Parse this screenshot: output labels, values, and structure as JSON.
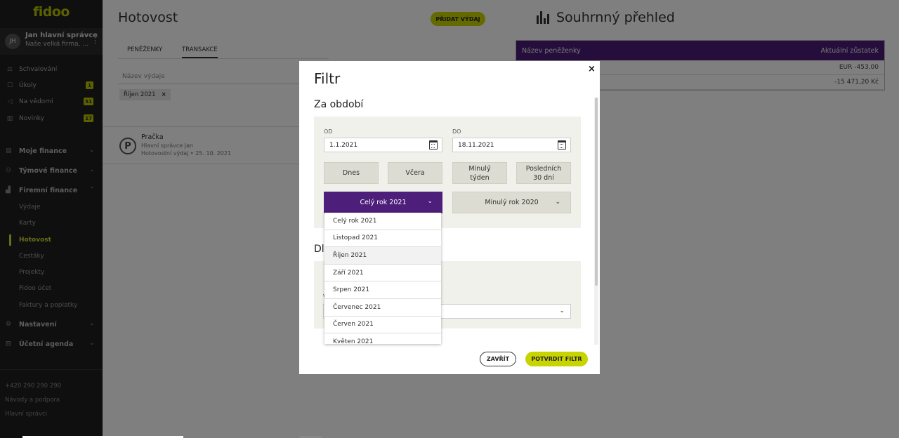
{
  "sidebar": {
    "logo": "fidoo",
    "user": {
      "initials": "JH",
      "name": "Jan hlavní správce",
      "company": "Naše velká firma, ..."
    },
    "quick": [
      {
        "label": "Schvalování",
        "badge": "",
        "icon": "approval-icon"
      },
      {
        "label": "Úkoly",
        "badge": "1",
        "icon": "tasks-icon"
      },
      {
        "label": "Na vědomí",
        "badge": "51",
        "icon": "megaphone-icon"
      },
      {
        "label": "Novinky",
        "badge": "17",
        "icon": "news-icon"
      }
    ],
    "sections": [
      {
        "label": "Moje finance"
      },
      {
        "label": "Týmové finance"
      },
      {
        "label": "Firemní finance"
      }
    ],
    "sub_items": [
      "Výdaje",
      "Karty",
      "Hotovost",
      "Cestáky",
      "Projekty",
      "Fidoo účet",
      "Faktury a poplatky"
    ],
    "lower_sections": [
      {
        "label": "Nastavení"
      },
      {
        "label": "Účetní agenda"
      }
    ],
    "footer": {
      "phone": "+420 290 290 290",
      "help": "Návody a podpora",
      "role": "Hlavní správci"
    }
  },
  "main": {
    "title": "Hotovost",
    "add_button": "PŘIDAT VÝDAJ",
    "tabs": [
      "PENĚŽENKY",
      "TRANSAKCE"
    ],
    "search_placeholder": "Název výdaje",
    "filter_chip": "Říjen 2021",
    "transaction": {
      "icon_letter": "P",
      "title": "Pračka",
      "sub1": "Hlavní správce Jan",
      "sub2": "Hotovostní výdaj • 25. 10. 2021"
    }
  },
  "summary": {
    "title": "Souhrnný přehled",
    "head_left": "Název peněženky",
    "head_right": "Aktuální zůstatek",
    "rows": [
      "EUR -453,00",
      "-15 471,20 Kč"
    ]
  },
  "modal": {
    "title": "Filtr",
    "close": "×",
    "section_period": "Za období",
    "section2_partial": "Dl",
    "section2_label_partial": "V",
    "from_label": "OD",
    "to_label": "DO",
    "from_value": "1.1.2021",
    "to_value": "18.11.2021",
    "quick_buttons": [
      "Dnes",
      "Včera",
      "Minulý\ntýden",
      "Posledních\n30 dní"
    ],
    "year_current": "Celý rok 2021",
    "year_previous": "Minulý rok 2020",
    "dropdown_options": [
      "Celý rok 2021",
      "Listopad 2021",
      "Říjen 2021",
      "Září 2021",
      "Srpen 2021",
      "Červenec 2021",
      "Červen 2021",
      "Květen 2021"
    ],
    "cancel": "ZAVŘÍT",
    "confirm": "POTVRDIT FILTR"
  }
}
